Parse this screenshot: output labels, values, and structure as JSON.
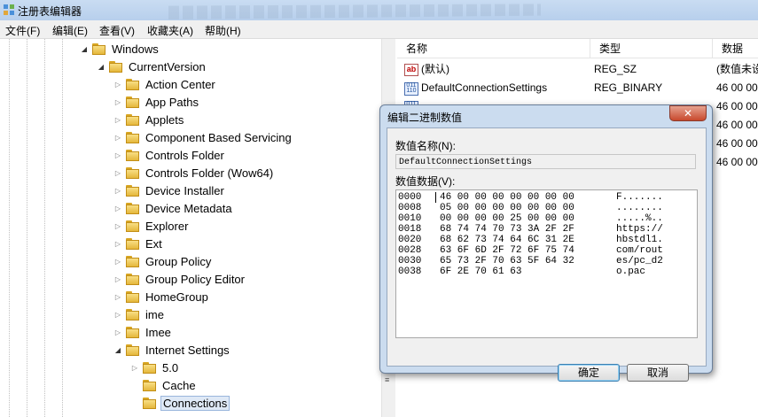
{
  "window": {
    "title": "注册表编辑器"
  },
  "menu": [
    "文件(F)",
    "编辑(E)",
    "查看(V)",
    "收藏夹(A)",
    "帮助(H)"
  ],
  "tree": [
    {
      "label": "Windows",
      "indent": 0,
      "expanded": true
    },
    {
      "label": "CurrentVersion",
      "indent": 1,
      "expanded": true
    },
    {
      "label": "Action Center",
      "indent": 2
    },
    {
      "label": "App Paths",
      "indent": 2
    },
    {
      "label": "Applets",
      "indent": 2
    },
    {
      "label": "Component Based Servicing",
      "indent": 2
    },
    {
      "label": "Controls Folder",
      "indent": 2
    },
    {
      "label": "Controls Folder (Wow64)",
      "indent": 2
    },
    {
      "label": "Device Installer",
      "indent": 2
    },
    {
      "label": "Device Metadata",
      "indent": 2
    },
    {
      "label": "Explorer",
      "indent": 2
    },
    {
      "label": "Ext",
      "indent": 2
    },
    {
      "label": "Group Policy",
      "indent": 2
    },
    {
      "label": "Group Policy Editor",
      "indent": 2
    },
    {
      "label": "HomeGroup",
      "indent": 2
    },
    {
      "label": "ime",
      "indent": 2
    },
    {
      "label": "Imee",
      "indent": 2
    },
    {
      "label": "Internet Settings",
      "indent": 2,
      "expanded": true
    },
    {
      "label": "5.0",
      "indent": 3
    },
    {
      "label": "Cache",
      "indent": 3,
      "leaf": true
    },
    {
      "label": "Connections",
      "indent": 3,
      "leaf": true,
      "selected": true
    }
  ],
  "list": {
    "columns": [
      "名称",
      "类型",
      "数据"
    ],
    "rows": [
      {
        "icon": "string-value-icon",
        "name": "(默认)",
        "type": "REG_SZ",
        "data": "(数值未设"
      },
      {
        "icon": "binary-value-icon",
        "name": "DefaultConnectionSettings",
        "type": "REG_BINARY",
        "data": "46 00 00"
      },
      {
        "icon": "binary-value-icon",
        "name": "",
        "type": "",
        "data": "46 00 00"
      },
      {
        "icon": "binary-value-icon",
        "name": "",
        "type": "",
        "data": "46 00 00"
      },
      {
        "icon": "binary-value-icon",
        "name": "",
        "type": "",
        "data": "46 00 00"
      },
      {
        "icon": "binary-value-icon",
        "name": "",
        "type": "",
        "data": "46 00 00"
      }
    ]
  },
  "dialog": {
    "title": "编辑二进制数值",
    "close_label": "✕",
    "value_name_label": "数值名称(N):",
    "value_name": "DefaultConnectionSettings",
    "value_data_label": "数值数据(V):",
    "hex_lines": [
      {
        "addr": "0000",
        "bytes": "46 00 00 00 00 00 00 00",
        "ascii": "F......."
      },
      {
        "addr": "0008",
        "bytes": "05 00 00 00 00 00 00 00",
        "ascii": "........"
      },
      {
        "addr": "0010",
        "bytes": "00 00 00 00 25 00 00 00",
        "ascii": ".....%.."
      },
      {
        "addr": "0018",
        "bytes": "68 74 74 70 73 3A 2F 2F",
        "ascii": "https://"
      },
      {
        "addr": "0020",
        "bytes": "68 62 73 74 64 6C 31 2E",
        "ascii": "hbstdl1."
      },
      {
        "addr": "0028",
        "bytes": "63 6F 6D 2F 72 6F 75 74",
        "ascii": "com/rout"
      },
      {
        "addr": "0030",
        "bytes": "65 73 2F 70 63 5F 64 32",
        "ascii": "es/pc_d2"
      },
      {
        "addr": "0038",
        "bytes": "6F 2E 70 61 63",
        "ascii": "o.pac"
      }
    ],
    "ok_label": "确定",
    "cancel_label": "取消"
  },
  "colors": {
    "titlebar": "#c9dcf2",
    "dialog_frame": "#cbdcef",
    "close_button": "#c8492d",
    "selection": "#dfe9f6"
  }
}
